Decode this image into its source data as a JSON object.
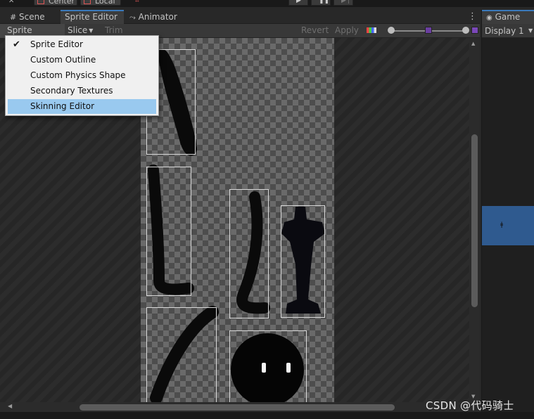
{
  "toolbar": {
    "center_label": "Center",
    "local_label": "Local"
  },
  "tabs": [
    {
      "label": "Scene",
      "icon": "grid-icon"
    },
    {
      "label": "Sprite Editor",
      "active": true
    },
    {
      "label": "Animator",
      "icon": "animator-icon"
    }
  ],
  "sprite_editor": {
    "mode_label": "Sprite Editor",
    "slice_label": "Slice",
    "trim_label": "Trim",
    "revert_label": "Revert",
    "apply_label": "Apply"
  },
  "menu": {
    "items": [
      {
        "label": "Sprite Editor",
        "checked": true
      },
      {
        "label": "Custom Outline"
      },
      {
        "label": "Custom Physics Shape"
      },
      {
        "label": "Secondary Textures"
      },
      {
        "label": "Skinning Editor",
        "highlighted": true
      }
    ]
  },
  "game": {
    "tab_label": "Game",
    "display_label": "Display 1"
  },
  "watermark": "CSDN @代码骑士",
  "colors": {
    "accent": "#3a79bb",
    "menu_highlight": "#99c9ef",
    "game_view": "#2f5a8f"
  }
}
